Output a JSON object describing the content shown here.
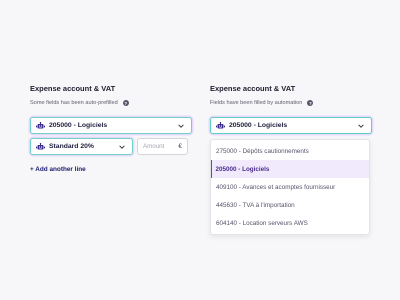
{
  "left": {
    "title": "Expense account & VAT",
    "subtitle": "Some fields has been auto-prefilled",
    "account_select": "205000 - Logiciels",
    "vat_select": "Standard 20%",
    "amount_placeholder": "Amount",
    "currency": "€",
    "add_line": "+ Add another line"
  },
  "right": {
    "title": "Expense account & VAT",
    "subtitle": "Fields have been filled by automation",
    "account_select": "205000 - Logiciels",
    "options": [
      {
        "label": "275000 - Dépôts cautionnements"
      },
      {
        "label": "205000 - Logiciels",
        "selected": true
      },
      {
        "label": "409100 - Avances et acomptes fournisseur"
      },
      {
        "label": "445630 - TVA à l'importation"
      },
      {
        "label": "604140 - Location serveurs AWS"
      }
    ]
  },
  "icons": {
    "help": "help-icon",
    "robot": "robot-icon",
    "chevron": "chevron-down-icon"
  },
  "colors": {
    "focus_border": "#6fd2ca",
    "selected_bg": "#f1eafd",
    "selected_text": "#4a2b8c",
    "brand": "#1b1b6b"
  }
}
